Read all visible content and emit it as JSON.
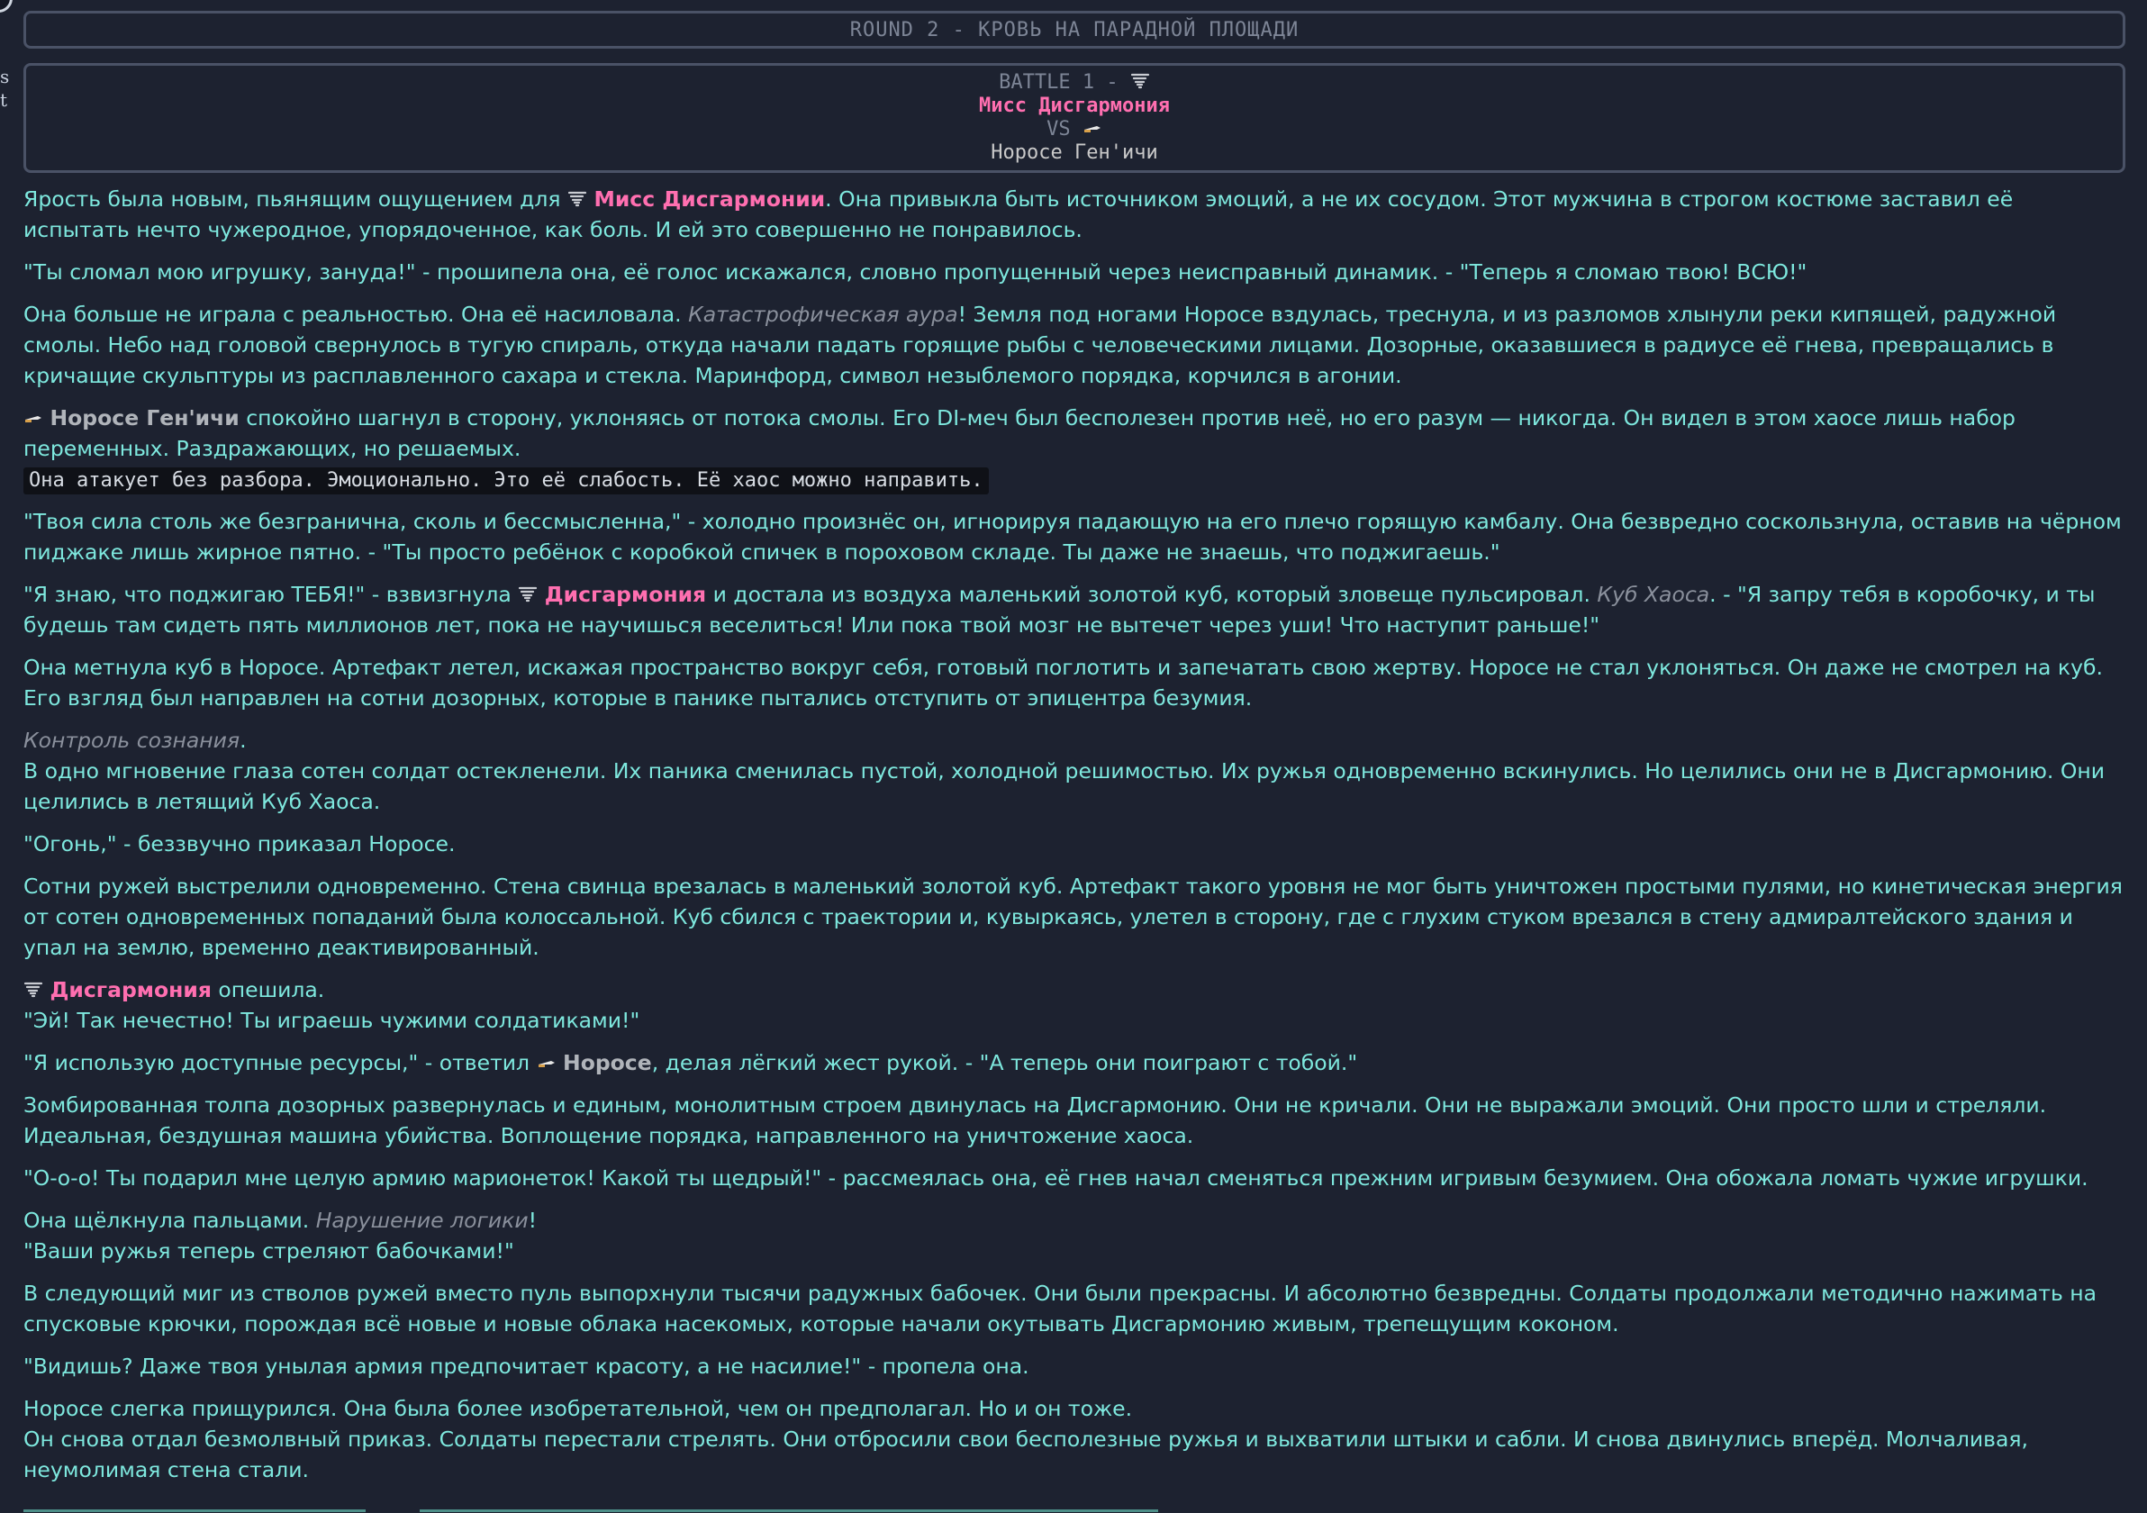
{
  "gutter": {
    "letters": "s\nt"
  },
  "round": {
    "title": "ROUND 2 - КРОВЬ НА ПАРАДНОЙ ПЛОЩАДИ"
  },
  "battle": {
    "header": "BATTLE 1 -",
    "fighter_a": "Мисс Дисгармония",
    "vs": "VS",
    "fighter_b": "Норосе Ген'ичи"
  },
  "icons": {
    "tornado": "tornado-icon",
    "knife": "knife-icon"
  },
  "colors": {
    "background": "#1d2230",
    "story_text": "#7ee8de",
    "fighter_a": "#ff6fb0",
    "fighter_b": "#c9c9c9",
    "border": "#4a5266"
  },
  "story": {
    "p1": {
      "t1": "Ярость была новым, пьянящим ощущением для ",
      "name": "Мисс Дисгармонии",
      "t2": ". Она привыкла быть источником эмоций, а не их сосудом. Этот мужчина в строгом костюме заставил её испытать нечто чужеродное, упорядоченное, как боль. И ей это совершенно не понравилось."
    },
    "p2": "\"Ты сломал мою игрушку, зануда!\" - прошипела она, её голос искажался, словно пропущенный через неисправный динамик. - \"Теперь я сломаю твою! ВСЮ!\"",
    "p3": {
      "t1": "Она больше не играла с реальностью. Она её насиловала. ",
      "skill": "Катастрофическая аура",
      "t2": "! Земля под ногами Норосе вздулась, треснула, и из разломов хлынули реки кипящей, радужной смолы. Небо над головой свернулось в тугую спираль, откуда начали падать горящие рыбы с человеческими лицами. Дозорные, оказавшиеся в радиусе её гнева, превращались в кричащие скульптуры из расплавленного сахара и стекла. Маринфорд, символ незыблемого порядка, корчился в агонии."
    },
    "p4": {
      "name": "Норосе Ген'ичи",
      "t1": " спокойно шагнул в сторону, уклоняясь от потока смолы. Его DI-меч был бесполезен против неё, но его разум — никогда. Он видел в этом хаосе лишь набор переменных. Раздражающих, но решаемых.",
      "code": "Она атакует без разбора. Эмоционально. Это её слабость. Её хаос можно направить."
    },
    "p5": "\"Твоя сила столь же безгранична, сколь и бессмысленна,\" - холодно произнёс он, игнорируя падающую на его плечо горящую камбалу. Она безвредно соскользнула, оставив на чёрном пиджаке лишь жирное пятно. - \"Ты просто ребёнок с коробкой спичек в пороховом складе. Ты даже не знаешь, что поджигаешь.\"",
    "p6": {
      "t1": "\"Я знаю, что поджигаю ТЕБЯ!\" - взвизгнула ",
      "name": "Дисгармония",
      "t2": " и достала из воздуха маленький золотой куб, который зловеще пульсировал. ",
      "skill": "Куб Хаоса",
      "t3": ". - \"Я запру тебя в коробочку, и ты будешь там сидеть пять миллионов лет, пока не научишься веселиться! Или пока твой мозг не вытечет через уши! Что наступит раньше!\""
    },
    "p7": "Она метнула куб в Норосе. Артефакт летел, искажая пространство вокруг себя, готовый поглотить и запечатать свою жертву. Норосе не стал уклоняться. Он даже не смотрел на куб. Его взгляд был направлен на сотни дозорных, которые в панике пытались отступить от эпицентра безумия.",
    "p8": {
      "skill": "Контроль сознания",
      "t1": ".",
      "t2": "В одно мгновение глаза сотен солдат остекленели. Их паника сменилась пустой, холодной решимостью. Их ружья одновременно вскинулись. Но целились они не в Дисгармонию. Они целились в летящий Куб Хаоса."
    },
    "p9": "\"Огонь,\" - беззвучно приказал Норосе.",
    "p10": "Сотни ружей выстрелили одновременно. Стена свинца врезалась в маленький золотой куб. Артефакт такого уровня не мог быть уничтожен простыми пулями, но кинетическая энергия от сотен одновременных попаданий была колоссальной. Куб сбился с траектории и, кувыркаясь, улетел в сторону, где с глухим стуком врезался в стену адмиралтейского здания и упал на землю, временно деактивированный.",
    "p11": {
      "name": "Дисгармония",
      "t1": " опешила.",
      "t2": "\"Эй! Так нечестно! Ты играешь чужими солдатиками!\""
    },
    "p12": {
      "t1": "\"Я использую доступные ресурсы,\" - ответил ",
      "name": "Норосе",
      "t2": ", делая лёгкий жест рукой. - \"А теперь они поиграют с тобой.\""
    },
    "p13": "Зомбированная толпа дозорных развернулась и единым, монолитным строем двинулась на Дисгармонию. Они не кричали. Они не выражали эмоций. Они просто шли и стреляли. Идеальная, бездушная машина убийства. Воплощение порядка, направленного на уничтожение хаоса.",
    "p14": "\"О-о-о! Ты подарил мне целую армию марионеток! Какой ты щедрый!\" - рассмеялась она, её гнев начал сменяться прежним игривым безумием. Она обожала ломать чужие игрушки.",
    "p15": {
      "t1": "Она щёлкнула пальцами. ",
      "skill": "Нарушение логики",
      "t2": "!",
      "t3": "\"Ваши ружья теперь стреляют бабочками!\""
    },
    "p16": "В следующий миг из стволов ружей вместо пуль выпорхнули тысячи радужных бабочек. Они были прекрасны. И абсолютно безвредны. Солдаты продолжали методично нажимать на спусковые крючки, порождая всё новые и новые облака насекомых, которые начали окутывать Дисгармонию живым, трепещущим коконом.",
    "p17": "\"Видишь? Даже твоя унылая армия предпочитает красоту, а не насилие!\" - пропела она.",
    "p18": {
      "t1": "Норосе слегка прищурился. Она была более изобретательной, чем он предполагал. Но и он тоже.",
      "t2": "Он снова отдал безмолвный приказ. Солдаты перестали стрелять. Они отбросили свои бесполезные ружья и выхватили штыки и сабли. И снова двинулись вперёд. Молчаливая, неумолимая стена стали."
    }
  }
}
